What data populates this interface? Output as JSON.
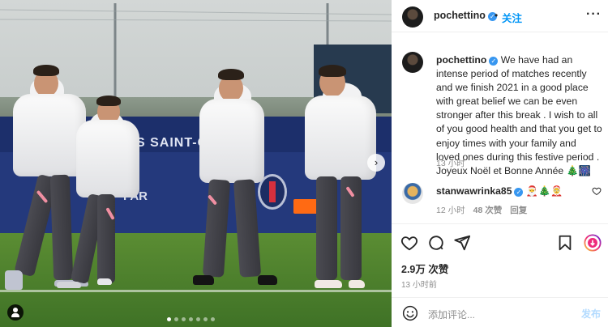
{
  "post": {
    "author": "pochettino",
    "follow_label": "关注",
    "separator": "•",
    "more_label": "···"
  },
  "photo_ads": {
    "board_top_text": "S SAINT-G      AIN",
    "board_bottom_text": "FAR"
  },
  "caption": {
    "username": "pochettino",
    "text": "We have had an intense period of matches recently and we finish 2021 in a good place with great belief we can be even stronger after this break . I wish to all of you good health and that you get to enjoy times with your family and loved ones during this festive period . Joyeux Noël et Bonne Année 🎄🎆",
    "time": "13 小时"
  },
  "comment": {
    "username": "stanwawrinka85",
    "emojis": "🎅🎄🤶",
    "time": "12 小时",
    "likes": "48 次赞",
    "reply_label": "回复"
  },
  "stats": {
    "likes": "2.9万 次赞",
    "posted": "13 小时前"
  },
  "add_comment": {
    "placeholder": "添加评论...",
    "post_label": "发布"
  },
  "carousel": {
    "next_arrow": "›",
    "total": 7,
    "active_index": 0
  },
  "icons": [
    "user-tag-icon",
    "chevron-right-icon",
    "verified-badge-icon",
    "heart-icon",
    "comment-icon",
    "share-icon",
    "bookmark-icon",
    "emoji-icon",
    "more-options-icon"
  ],
  "colors": {
    "accent": "#0095f6",
    "verified": "#3897f0",
    "muted": "#8e8e8e",
    "post_disabled": "#b3dbff"
  }
}
